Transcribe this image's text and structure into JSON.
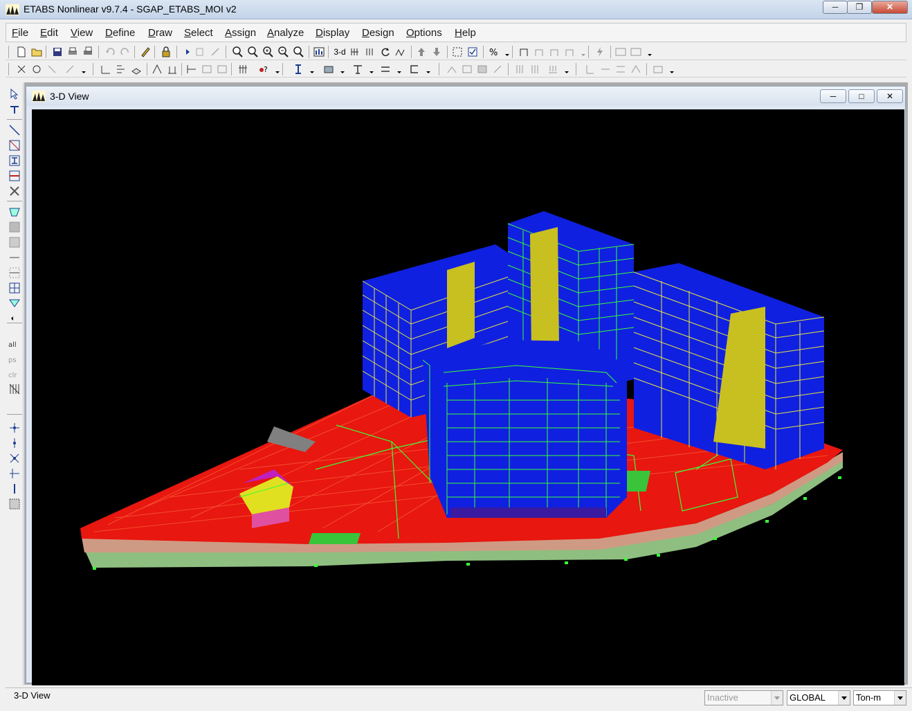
{
  "window": {
    "title": "ETABS Nonlinear v9.7.4 - SGAP_ETABS_MOI v2",
    "minimize_icon": "minimize-icon",
    "maximize_icon": "restore-icon",
    "close_icon": "close-icon"
  },
  "menu": [
    {
      "label": "File",
      "key": "F",
      "rest": "ile"
    },
    {
      "label": "Edit",
      "key": "E",
      "rest": "dit"
    },
    {
      "label": "View",
      "key": "V",
      "rest": "iew"
    },
    {
      "label": "Define",
      "key": "D",
      "rest": "efine"
    },
    {
      "label": "Draw",
      "key": "D",
      "rest": "raw"
    },
    {
      "label": "Select",
      "key": "S",
      "rest": "elect"
    },
    {
      "label": "Assign",
      "key": "A",
      "rest": "ssign"
    },
    {
      "label": "Analyze",
      "key": "A",
      "rest": "nalyze"
    },
    {
      "label": "Display",
      "key": "D",
      "rest": "isplay"
    },
    {
      "label": "Design",
      "key": "D",
      "rest": "esign"
    },
    {
      "label": "Options",
      "key": "O",
      "rest": "ptions"
    },
    {
      "label": "Help",
      "key": "H",
      "rest": "elp"
    }
  ],
  "toolbar1": {
    "three_d_label": "3-d"
  },
  "child_window": {
    "title": "3-D View"
  },
  "statusbar": {
    "text": "3-D View",
    "combo_inactive": "Inactive",
    "combo_coord": "GLOBAL",
    "combo_units": "Ton-m"
  },
  "colors": {
    "slab": "#e8170f",
    "wall_blue": "#1020e0",
    "frame_green": "#39ff39",
    "frame_yellow": "#e6e640",
    "core_yellow": "#c8c020"
  }
}
